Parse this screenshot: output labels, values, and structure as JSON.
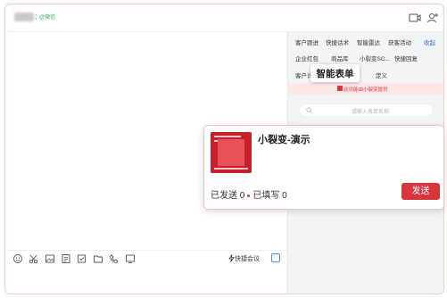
{
  "header": {
    "contact_separator": ";",
    "contact_tag": "@微信"
  },
  "tabs_row1": [
    "客户跟进",
    "快捷话术",
    "智能雷达",
    "获客活动",
    "收起"
  ],
  "tabs_row2": [
    "企业红包",
    "商品库",
    "小裂变SC...",
    "快捷回复"
  ],
  "tabs_row3": [
    "客户详情",
    "定义"
  ],
  "notice": {
    "text": "此功能由小裂变提供"
  },
  "search": {
    "placeholder": "请输入表单名称"
  },
  "popup": {
    "title": "智能表单"
  },
  "card": {
    "title": "小裂变-演示",
    "sent_label": "已发送 0",
    "filled_label": "已填写 0",
    "send_label": "发送"
  },
  "toolbar": {
    "meeting_label": "快捷会议"
  },
  "colors": {
    "accent_red": "#d8363b",
    "link_blue": "#2f6fd8",
    "wechat_green": "#33b04a"
  }
}
